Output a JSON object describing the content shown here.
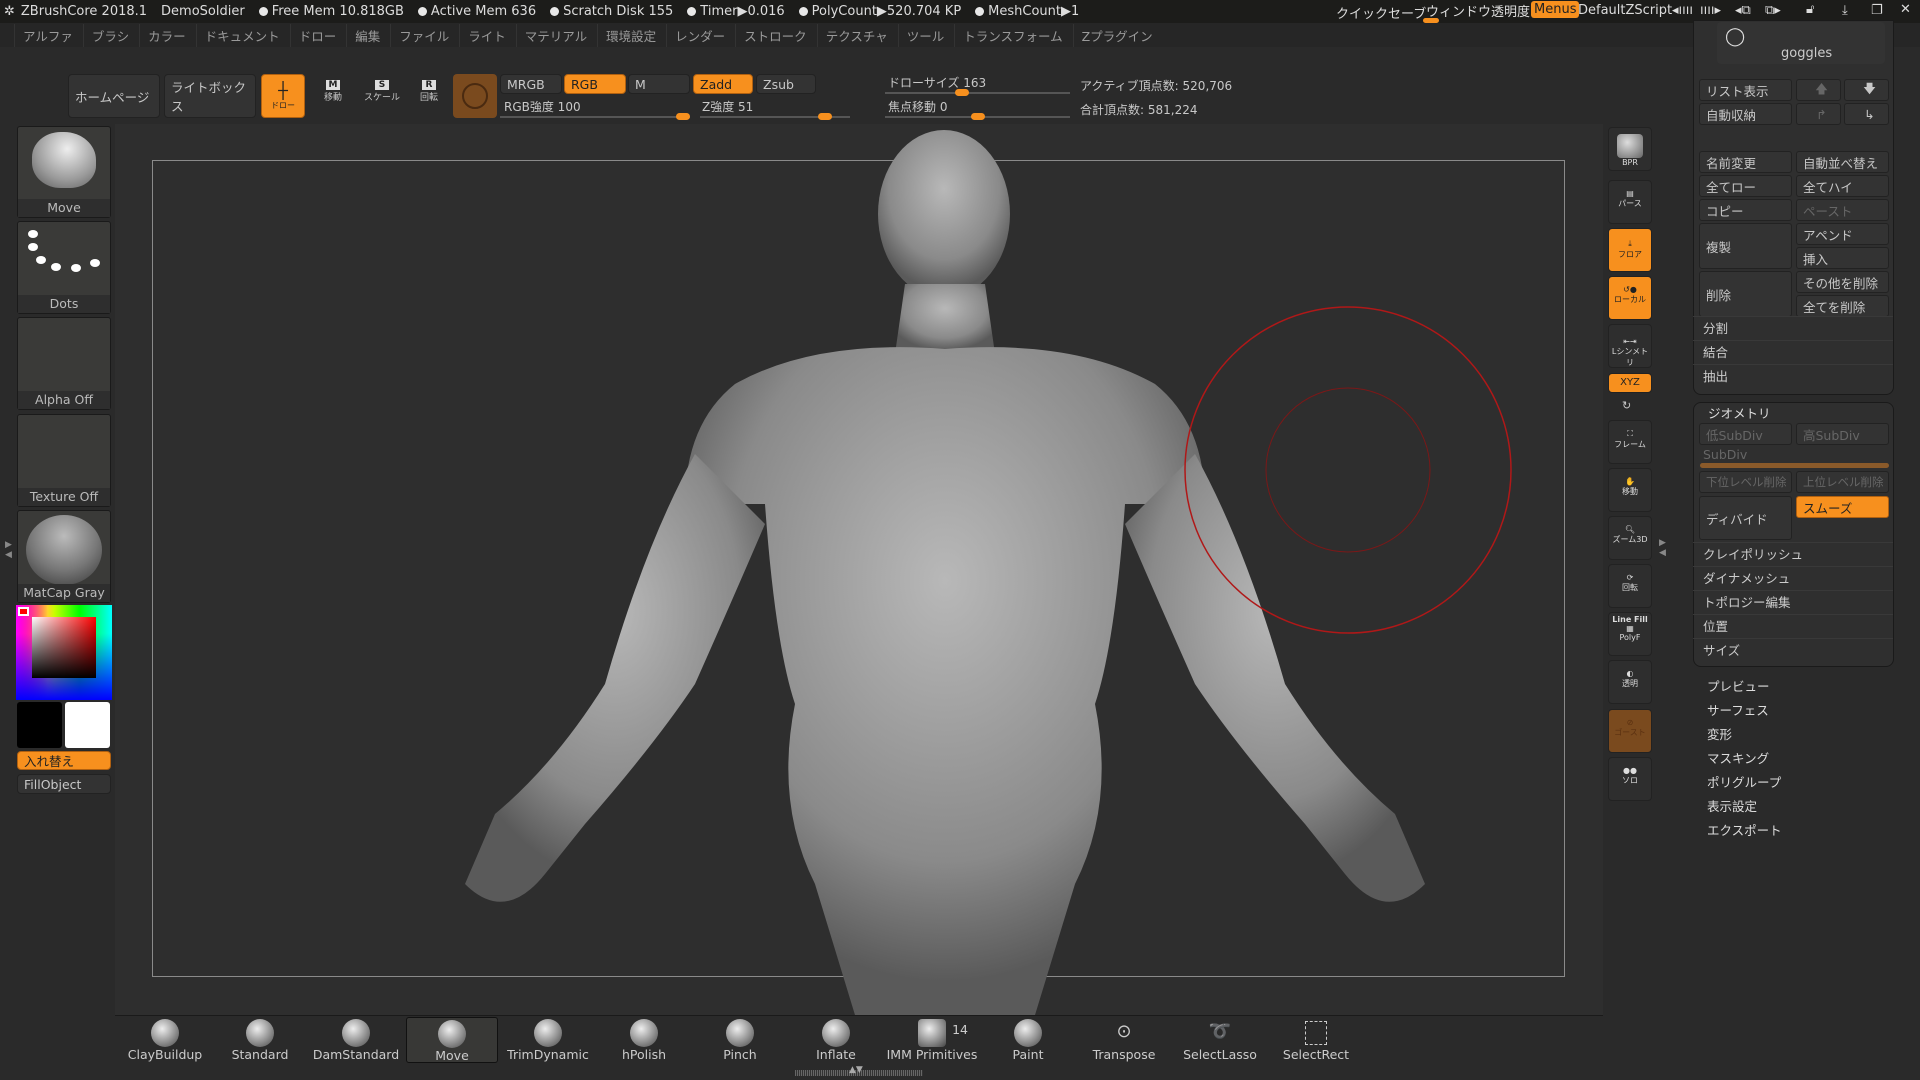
{
  "titlebar": {
    "app": "ZBrushCore 2018.1",
    "project": "DemoSoldier",
    "free_mem": "Free Mem 10.818GB",
    "active_mem": "Active Mem 636",
    "scratch": "Scratch Disk 155",
    "timer": "Timer▶0.016",
    "polycount": "PolyCount▶520.704 KP",
    "meshcount": "MeshCount▶1",
    "quicksave": "クイックセーブ",
    "transparency": "ウィンドウ透明度",
    "menus": "Menus",
    "zscript": "DefaultZScript"
  },
  "menus": [
    "アルファ",
    "ブラシ",
    "カラー",
    "ドキュメント",
    "ドロー",
    "編集",
    "ファイル",
    "ライト",
    "マテリアル",
    "環境設定",
    "レンダー",
    "ストローク",
    "テクスチャ",
    "ツール",
    "トランスフォーム",
    "Zプラグイン"
  ],
  "toolbar": {
    "home": "ホームページ",
    "lightbox": "ライトボックス",
    "draw": "ドロー",
    "move": "移動",
    "scale": "スケール",
    "rotate": "回転",
    "mrgb": "MRGB",
    "rgb": "RGB",
    "m": "M",
    "zadd": "Zadd",
    "zsub": "Zsub",
    "rgb_intensity": "RGB強度 100",
    "z_intensity": "Z強度 51",
    "draw_size": "ドローサイズ 163",
    "focal_shift": "焦点移動 0",
    "active_points": "アクティブ頂点数: 520,706",
    "total_points": "合計頂点数: 581,224",
    "rgb_intensity_value": 100,
    "z_intensity_value": 51,
    "draw_size_value": 163,
    "focal_shift_value": 0
  },
  "left": {
    "brush": "Move",
    "stroke": "Dots",
    "alpha": "Alpha Off",
    "texture": "Texture Off",
    "material": "MatCap Gray",
    "swap": "入れ替え",
    "fill": "FillObject",
    "main_color": "#ff0000",
    "primary": "#000000",
    "secondary": "#ffffff"
  },
  "shelf": {
    "bpr": "BPR",
    "persp": "パース",
    "floor": "フロア",
    "local": "ローカル",
    "symmetry": "Lシンメトリ",
    "xyz": "XYZ",
    "frame": "フレーム",
    "move": "移動",
    "zoom": "ズーム3D",
    "rotate": "回転",
    "linefill": "Line Fill",
    "polyf": "PolyF",
    "transp": "透明",
    "ghost": "ゴースト",
    "solo": "ソロ"
  },
  "subtool": {
    "name": "goggles",
    "list": "リスト表示",
    "autocollapse": "自動収納",
    "rename": "名前変更",
    "autoreorder": "自動並べ替え",
    "alllow": "全てロー",
    "allhigh": "全てハイ",
    "copy": "コピー",
    "paste": "ペースト",
    "duplicate": "複製",
    "append": "アペンド",
    "insert": "挿入",
    "delete": "削除",
    "delother": "その他を削除",
    "delall": "全てを削除",
    "split": "分割",
    "merge": "結合",
    "extract": "抽出"
  },
  "geometry": {
    "title": "ジオメトリ",
    "lower": "低SubDiv",
    "higher": "高SubDiv",
    "subdiv": "SubDiv",
    "dellower": "下位レベル削除",
    "delhigher": "上位レベル削除",
    "divide": "ディバイド",
    "smooth": "スムーズ",
    "items": [
      "クレイポリッシュ",
      "ダイナメッシュ",
      "トポロジー編集",
      "位置",
      "サイズ"
    ]
  },
  "subpanels": [
    "プレビュー",
    "サーフェス",
    "変形",
    "マスキング",
    "ポリグループ",
    "表示設定",
    "エクスポート"
  ],
  "brushes": [
    {
      "label": "ClayBuildup"
    },
    {
      "label": "Standard"
    },
    {
      "label": "DamStandard"
    },
    {
      "label": "Move"
    },
    {
      "label": "TrimDynamic"
    },
    {
      "label": "hPolish"
    },
    {
      "label": "Pinch"
    },
    {
      "label": "Inflate"
    },
    {
      "label": "IMM Primitives",
      "badge": "14"
    },
    {
      "label": "Paint"
    },
    {
      "label": "Transpose"
    },
    {
      "label": "SelectLasso"
    },
    {
      "label": "SelectRect"
    }
  ],
  "accent": "#f7901e"
}
